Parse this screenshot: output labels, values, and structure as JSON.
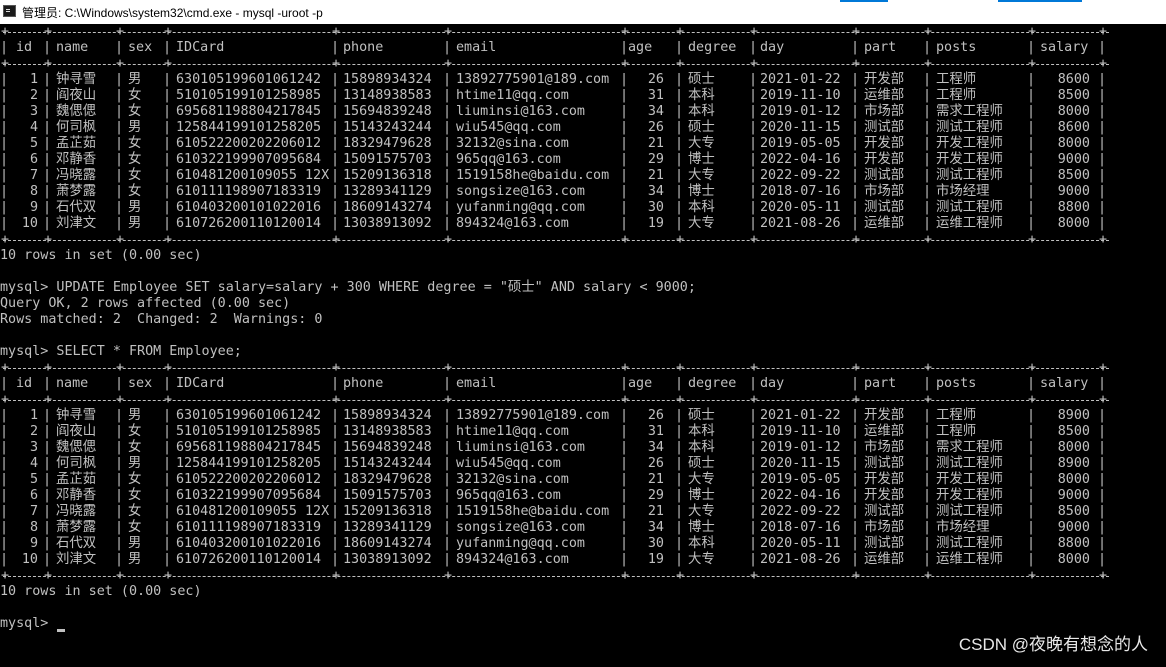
{
  "window": {
    "title": "管理员: C:\\Windows\\system32\\cmd.exe - mysql  -uroot -p"
  },
  "table1": {
    "columns": [
      "id",
      "name",
      "sex",
      "IDCard",
      "phone",
      "email",
      "age",
      "degree",
      "day",
      "part",
      "posts",
      "salary"
    ],
    "rows": [
      [
        "1",
        "钟寻雪",
        "男",
        "630105199601061242",
        "15898934324",
        "13892775901@189.com",
        "26",
        "硕士",
        "2021-01-22",
        "开发部",
        "工程师",
        "8600"
      ],
      [
        "2",
        "阎夜山",
        "女",
        "510105199101258985",
        "13148938583",
        "htime11@qq.com",
        "31",
        "本科",
        "2019-11-10",
        "运维部",
        "工程师",
        "8500"
      ],
      [
        "3",
        "魏偲偲",
        "女",
        "695681198804217845",
        "15694839248",
        "liuminsi@163.com",
        "34",
        "本科",
        "2019-01-12",
        "市场部",
        "需求工程师",
        "8000"
      ],
      [
        "4",
        "何司枫",
        "男",
        "125844199101258205",
        "15143243244",
        "wiu545@qq.com",
        "26",
        "硕士",
        "2020-11-15",
        "测试部",
        "测试工程师",
        "8600"
      ],
      [
        "5",
        "孟芷茹",
        "女",
        "610522200202206012",
        "18329479628",
        "32132@sina.com",
        "21",
        "大专",
        "2019-05-05",
        "开发部",
        "开发工程师",
        "8000"
      ],
      [
        "6",
        "邓静香",
        "女",
        "610322199907095684",
        "15091575703",
        "965qq@163.com",
        "29",
        "博士",
        "2022-04-16",
        "开发部",
        "开发工程师",
        "9000"
      ],
      [
        "7",
        "冯晓露",
        "女",
        "610481200109055 12X",
        "15209136318",
        "1519158he@baidu.com",
        "21",
        "大专",
        "2022-09-22",
        "测试部",
        "测试工程师",
        "8500"
      ],
      [
        "8",
        "萧梦露",
        "女",
        "610111198907183319",
        "13289341129",
        "songsize@163.com",
        "34",
        "博士",
        "2018-07-16",
        "市场部",
        "市场经理",
        "9000"
      ],
      [
        "9",
        "石代双",
        "男",
        "610403200101022016",
        "18609143274",
        "yufanming@qq.com",
        "30",
        "本科",
        "2020-05-11",
        "测试部",
        "测试工程师",
        "8800"
      ],
      [
        "10",
        "刘津文",
        "男",
        "610726200110120014",
        "13038913092",
        "894324@163.com",
        "19",
        "大专",
        "2021-08-26",
        "运维部",
        "运维工程师",
        "8000"
      ]
    ],
    "footer": "10 rows in set (0.00 sec)"
  },
  "session": {
    "update_command": "mysql> UPDATE Employee SET salary=salary + 300 WHERE degree = \"硕士\" AND salary < 9000;",
    "query_ok": "Query OK, 2 rows affected (0.00 sec)",
    "rows_matched": "Rows matched: 2  Changed: 2  Warnings: 0",
    "select_command": "mysql> SELECT * FROM Employee;",
    "prompt": "mysql> "
  },
  "table2": {
    "rows": [
      [
        "1",
        "钟寻雪",
        "男",
        "630105199601061242",
        "15898934324",
        "13892775901@189.com",
        "26",
        "硕士",
        "2021-01-22",
        "开发部",
        "工程师",
        "8900"
      ],
      [
        "2",
        "阎夜山",
        "女",
        "510105199101258985",
        "13148938583",
        "htime11@qq.com",
        "31",
        "本科",
        "2019-11-10",
        "运维部",
        "工程师",
        "8500"
      ],
      [
        "3",
        "魏偲偲",
        "女",
        "695681198804217845",
        "15694839248",
        "liuminsi@163.com",
        "34",
        "本科",
        "2019-01-12",
        "市场部",
        "需求工程师",
        "8000"
      ],
      [
        "4",
        "何司枫",
        "男",
        "125844199101258205",
        "15143243244",
        "wiu545@qq.com",
        "26",
        "硕士",
        "2020-11-15",
        "测试部",
        "测试工程师",
        "8900"
      ],
      [
        "5",
        "孟芷茹",
        "女",
        "610522200202206012",
        "18329479628",
        "32132@sina.com",
        "21",
        "大专",
        "2019-05-05",
        "开发部",
        "开发工程师",
        "8000"
      ],
      [
        "6",
        "邓静香",
        "女",
        "610322199907095684",
        "15091575703",
        "965qq@163.com",
        "29",
        "博士",
        "2022-04-16",
        "开发部",
        "开发工程师",
        "9000"
      ],
      [
        "7",
        "冯晓露",
        "女",
        "610481200109055 12X",
        "15209136318",
        "1519158he@baidu.com",
        "21",
        "大专",
        "2022-09-22",
        "测试部",
        "测试工程师",
        "8500"
      ],
      [
        "8",
        "萧梦露",
        "女",
        "610111198907183319",
        "13289341129",
        "songsize@163.com",
        "34",
        "博士",
        "2018-07-16",
        "市场部",
        "市场经理",
        "9000"
      ],
      [
        "9",
        "石代双",
        "男",
        "610403200101022016",
        "18609143274",
        "yufanming@qq.com",
        "30",
        "本科",
        "2020-05-11",
        "测试部",
        "测试工程师",
        "8800"
      ],
      [
        "10",
        "刘津文",
        "男",
        "610726200110120014",
        "13038913092",
        "894324@163.com",
        "19",
        "大专",
        "2021-08-26",
        "运维部",
        "运维工程师",
        "8000"
      ]
    ],
    "footer": "10 rows in set (0.00 sec)"
  },
  "watermark": "CSDN @夜晚有想念的人"
}
